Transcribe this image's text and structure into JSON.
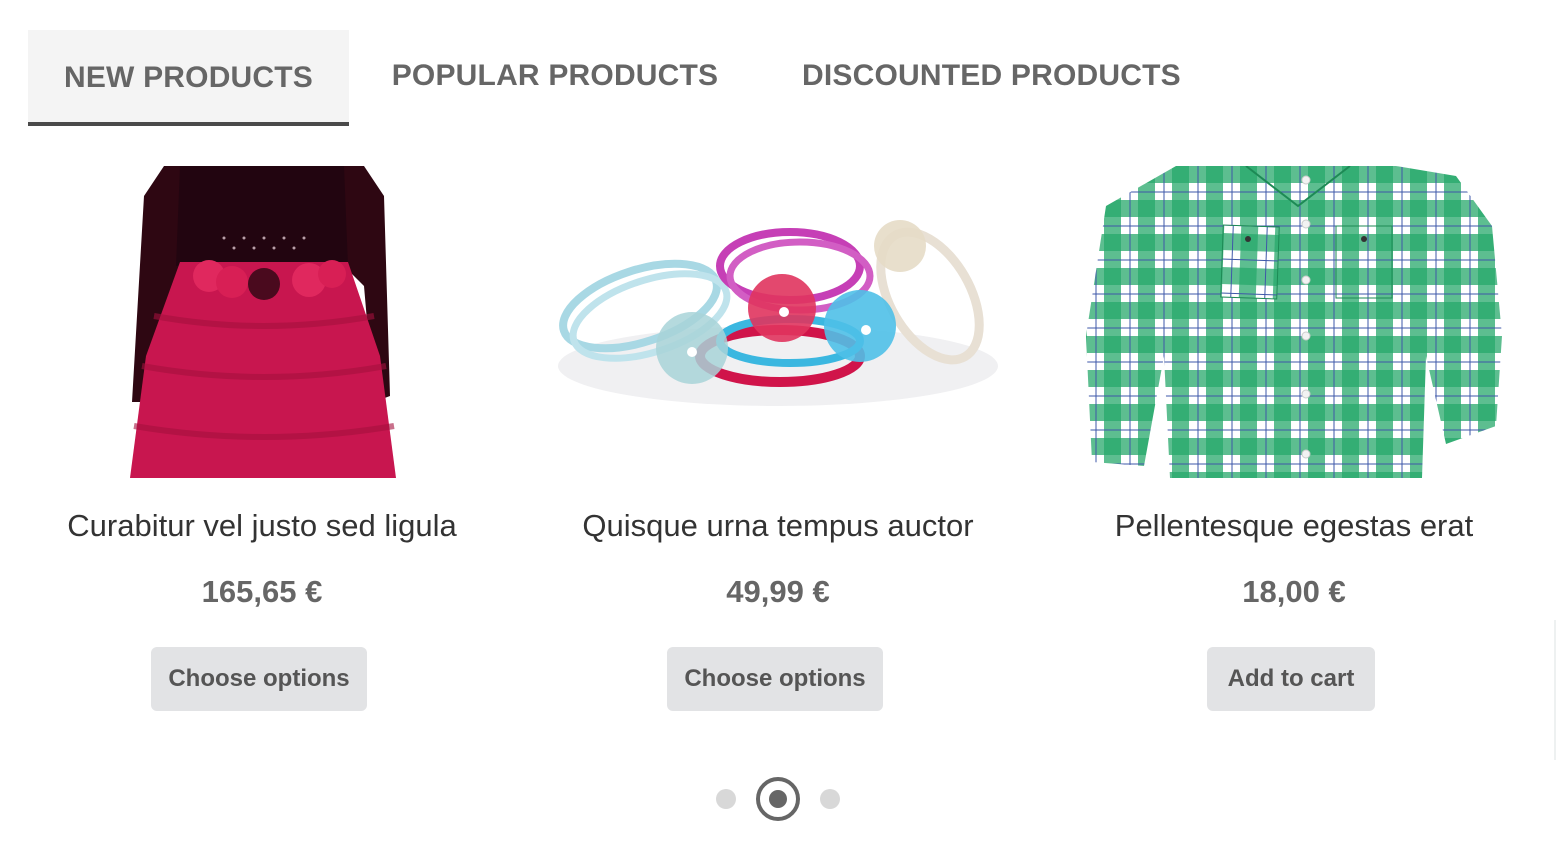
{
  "tabs": [
    {
      "label": "NEW PRODUCTS",
      "active": true
    },
    {
      "label": "POPULAR PRODUCTS",
      "active": false
    },
    {
      "label": "DISCOUNTED PRODUCTS",
      "active": false
    }
  ],
  "products": [
    {
      "name": "Curabitur vel justo sed ligula",
      "price": "165,65 €",
      "button": "Choose options",
      "image": "girls-red-velvet-tutu-dress"
    },
    {
      "name": "Quisque urna tempus auctor",
      "price": "49,99 €",
      "button": "Choose options",
      "image": "flower-hair-ties-set"
    },
    {
      "name": "Pellentesque egestas erat",
      "price": "18,00 €",
      "button": "Add to cart",
      "image": "green-plaid-shirt"
    }
  ],
  "carousel": {
    "pages": 3,
    "current": 2
  },
  "colors": {
    "tab_active_bg": "#f4f4f4",
    "tab_indicator": "#4a4a4a",
    "button_bg": "#e2e3e5",
    "text_muted": "#666666"
  }
}
